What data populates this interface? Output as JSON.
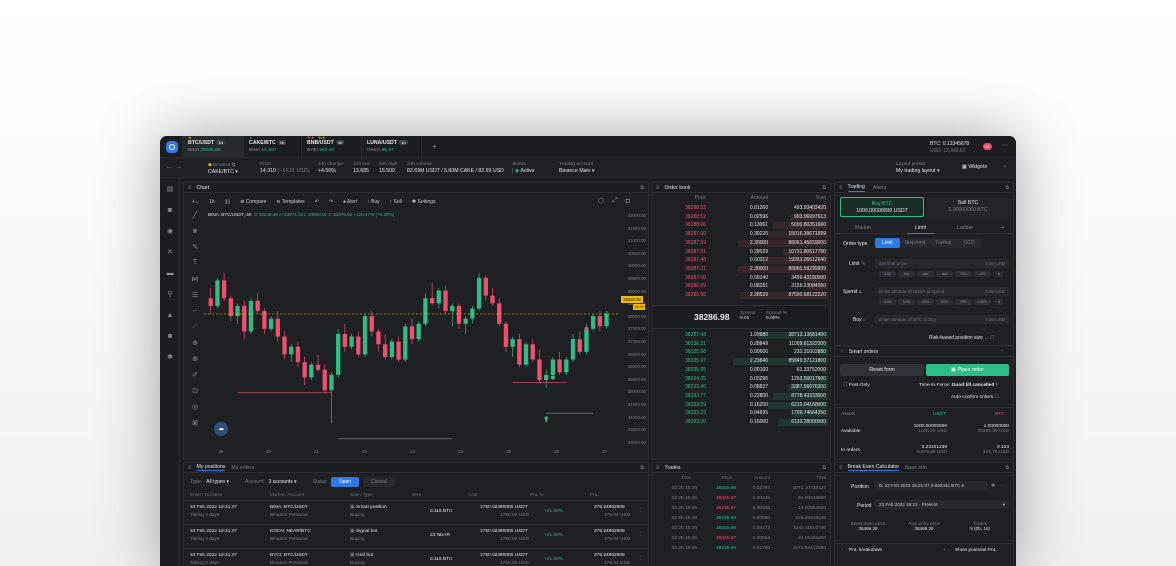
{
  "colors": {
    "green": "#2ebd85",
    "red": "#f0506e",
    "accent": "#2c7be5",
    "bg": "#1e2024",
    "yellow": "#f0b90b"
  },
  "tabs": [
    {
      "pair": "BTC/USDT",
      "badge": "1h",
      "exchange": "BINA",
      "price": "38286.98"
    },
    {
      "pair": "CAKE/BTC",
      "badge": "1h",
      "exchange": "BINA",
      "price": "14.310"
    },
    {
      "pair": "BNB/USDT",
      "badge": "4h",
      "exchange": "BYBI",
      "price": "382.15"
    },
    {
      "pair": "LUNA/USDT",
      "badge": "1h",
      "exchange": "OKEX",
      "price": "65.97"
    }
  ],
  "account": {
    "balance_btc": "BTC: 0.12345678",
    "balance_usd": "USD: 12,345.67",
    "notif": "9+"
  },
  "info": {
    "exchange_label": "Binance",
    "pair": "CAKE/BTC",
    "price_label": "Price",
    "price": "14.310",
    "price_usd": "(~14.31 USD)",
    "change_label": "24h change",
    "change": "+4.56%",
    "low_label": "24h low",
    "low": "13.685",
    "high_label": "24h high",
    "high": "15.500",
    "volume_label": "24h volume",
    "volume": "82.69M USDT / 5.60M CAKE / 82.69 USD",
    "status_label": "Status",
    "status": "Active",
    "account_label": "Trading account",
    "account": "Binance Main",
    "layout_label": "Layout preset",
    "layout": "My trading layout",
    "widgets": "Widgets"
  },
  "chart": {
    "title": "Chart",
    "interval": "1h",
    "compare": "Compare",
    "templates": "Templates",
    "alert": "Alert",
    "buy": "Buy",
    "sell": "Sell",
    "settings": "Settings",
    "symbol": "BINA: BTC/USDT, 60",
    "ohlc": "O 33248.96  H 33574.32  L 33050.02  C 33378.02  +129.47% (+0.39%)",
    "price_tag": "38286.98",
    "time_tag": "14:34",
    "x_ticks": [
      "19",
      "20",
      "21",
      "22",
      "23",
      "24",
      "25",
      "26",
      "27"
    ],
    "y_ticks": [
      "42000.00",
      "41500.00",
      "41000.00",
      "40500.00",
      "40000.00",
      "39500.00",
      "39000.00",
      "38500.00",
      "38000.00",
      "37500.00",
      "37000.00",
      "36500.00",
      "36000.00",
      "35500.00",
      "35000.00",
      "34500.00",
      "34000.00",
      "33500.00",
      "33000.00"
    ]
  },
  "chart_data": {
    "type": "candlestick",
    "ylim": [
      33000,
      42000
    ],
    "x_ticks": [
      "19",
      "20",
      "21",
      "22",
      "23",
      "24",
      "25",
      "26",
      "27"
    ],
    "candles": [
      [
        38900,
        39300,
        38300,
        38600
      ],
      [
        38600,
        39700,
        38500,
        39600
      ],
      [
        39600,
        39900,
        38800,
        38900
      ],
      [
        38900,
        39000,
        38000,
        38200
      ],
      [
        38200,
        38700,
        37900,
        38600
      ],
      [
        38600,
        38800,
        37300,
        37600
      ],
      [
        37600,
        38900,
        37500,
        38800
      ],
      [
        38800,
        39100,
        38300,
        38400
      ],
      [
        38400,
        38500,
        37500,
        37700
      ],
      [
        37700,
        38200,
        37600,
        38100
      ],
      [
        38100,
        38400,
        37200,
        37400
      ],
      [
        37400,
        37600,
        36500,
        36700
      ],
      [
        36700,
        37100,
        36400,
        37000
      ],
      [
        37000,
        37200,
        36200,
        36400
      ],
      [
        36400,
        36600,
        35500,
        35800
      ],
      [
        35800,
        36400,
        35700,
        36300
      ],
      [
        36300,
        36700,
        36000,
        36100
      ],
      [
        36100,
        36300,
        35200,
        35300
      ],
      [
        35300,
        36000,
        34000,
        35900
      ],
      [
        35900,
        37700,
        35800,
        37500
      ],
      [
        37500,
        37900,
        36800,
        37000
      ],
      [
        37000,
        37500,
        36900,
        37400
      ],
      [
        37400,
        37600,
        36600,
        36700
      ],
      [
        36700,
        38300,
        36600,
        38200
      ],
      [
        38200,
        38400,
        37400,
        37600
      ],
      [
        37600,
        37700,
        36800,
        37100
      ],
      [
        37100,
        37500,
        36500,
        36600
      ],
      [
        36600,
        37300,
        36500,
        37200
      ],
      [
        37200,
        37400,
        36400,
        36500
      ],
      [
        36500,
        37900,
        36400,
        37800
      ],
      [
        37800,
        38100,
        37100,
        37300
      ],
      [
        37300,
        38000,
        37200,
        37900
      ],
      [
        37900,
        39100,
        37800,
        38900
      ],
      [
        38900,
        39500,
        38600,
        38700
      ],
      [
        38700,
        39300,
        38500,
        39200
      ],
      [
        39200,
        39400,
        38300,
        38400
      ],
      [
        38400,
        38700,
        37800,
        38600
      ],
      [
        38600,
        38700,
        37700,
        37900
      ],
      [
        37900,
        38200,
        37500,
        38100
      ],
      [
        38100,
        38600,
        37900,
        38500
      ],
      [
        38500,
        39900,
        38400,
        39700
      ],
      [
        39700,
        39800,
        38800,
        39000
      ],
      [
        39000,
        39300,
        38600,
        38700
      ],
      [
        38700,
        38900,
        37800,
        37900
      ],
      [
        37900,
        38000,
        36800,
        37000
      ],
      [
        37000,
        37400,
        36600,
        37300
      ],
      [
        37300,
        37500,
        36200,
        36300
      ],
      [
        36300,
        37200,
        36200,
        37100
      ],
      [
        37100,
        37300,
        36400,
        36500
      ],
      [
        36500,
        36900,
        35600,
        35700
      ],
      [
        35700,
        36100,
        35400,
        35900
      ],
      [
        35900,
        36600,
        35800,
        36500
      ],
      [
        36500,
        36800,
        35900,
        36000
      ],
      [
        36000,
        36600,
        35900,
        36500
      ],
      [
        36500,
        37500,
        36400,
        37300
      ],
      [
        37300,
        37600,
        36700,
        36800
      ],
      [
        36800,
        37900,
        36700,
        37700
      ],
      [
        37700,
        38300,
        37600,
        38200
      ],
      [
        38200,
        38400,
        37600,
        37800
      ],
      [
        37800,
        38400,
        37700,
        38300
      ]
    ]
  },
  "orderbook": {
    "title": "Order book",
    "headers": [
      "Price",
      "Amount",
      "Sum"
    ],
    "asks": [
      [
        "38288.52",
        "0.01260",
        "493.93403420"
      ],
      [
        "38288.52",
        "0.02596",
        "993.96997613"
      ],
      [
        "38288.06",
        "0.13061",
        "5000.80351660"
      ],
      [
        "38287.60",
        "0.39220",
        "15016.39671999"
      ],
      [
        "38287.59",
        "2.30000",
        "88061.45659000"
      ],
      [
        "38287.51",
        "0.28029",
        "10731.80617790"
      ],
      [
        "38287.48",
        "0.50312",
        "19263.06612640"
      ],
      [
        "38287.21",
        "2.30000",
        "88060.58299999"
      ],
      [
        "38287.00",
        "0.09140",
        "3499.43180000"
      ],
      [
        "38286.99",
        "0.08281",
        "3155.23084560"
      ],
      [
        "38286.98",
        "2.28539",
        "87500.68122220"
      ]
    ],
    "spread_price": "38286.98",
    "spread_label": "Spread",
    "spread_value": "0.01",
    "spread_pct_label": "Spread %",
    "spread_pct": "0.00%",
    "bids": [
      [
        "38287.43",
        "1.00980",
        "38713.13681400"
      ],
      [
        "38336.21",
        "0.28849",
        "11059.61322200"
      ],
      [
        "38335.98",
        "0.00606",
        "232.31603880"
      ],
      [
        "38335.97",
        "2.23840",
        "85849.57121800"
      ],
      [
        "38335.95",
        "0.00160",
        "61.33752000"
      ],
      [
        "38334.35",
        "0.03296",
        "1263.50017600"
      ],
      [
        "38333.40",
        "0.08837",
        "3387.56676300"
      ],
      [
        "38333.77",
        "0.22800",
        "8778.43333000"
      ],
      [
        "38333.59",
        "0.16200",
        "6210.04168000"
      ],
      [
        "38333.23",
        "0.04695",
        "1799.74664350"
      ],
      [
        "38333.00",
        "0.16000",
        "6133.28000000"
      ]
    ]
  },
  "trading": {
    "tabs": [
      "Trading",
      "Alerts"
    ],
    "buy_label": "Buy BTC",
    "buy_amount": "1000.00000000 USDT",
    "sell_label": "Sell BTC",
    "sell_amount": "1.00000000 BTC",
    "modes": [
      "Market",
      "Limit",
      "Ladder"
    ],
    "order_type_label": "Order type",
    "order_types": [
      "Limit",
      "Stop limit",
      "Trailing",
      "OCO"
    ],
    "limit_label": "Limit",
    "limit_placeholder": "Set limit price",
    "limit_unit": "0.00 USD",
    "limit_pills": [
      "0.00",
      "bid",
      "ask",
      "last",
      "+5%",
      "-5%"
    ],
    "spend_label": "Spend",
    "spend_placeholder": "Enter amount of USDT to spend",
    "spend_unit": "0.00 USD",
    "spend_pills": [
      "0.00",
      "10%",
      "25%",
      "50%",
      "75%",
      "100%"
    ],
    "buy_field_label": "Buy",
    "buy_placeholder": "Enter amount of BTC to buy",
    "buy_unit": "0.00 USD",
    "risk": "Risk-based position size",
    "smart_orders": "Smart orders",
    "reset": "Reset form",
    "place": "Place order",
    "post_only": "Post-Only",
    "tif_label": "Time-In-Force:",
    "tif": "Good till cancelled",
    "auto_confirm": "Auto-confirm orders",
    "assets_label": "Assets",
    "assets_usdt": "USDT",
    "assets_btc": "BTC",
    "available_label": "Available",
    "avail_usdt": "1000.00000000",
    "avail_usdt_usd": "1000.00 USD",
    "avail_btc": "1.00000000",
    "avail_btc_usd": "38286.98 USD",
    "inorders_label": "In orders",
    "inorders_usdt": "0.23101239",
    "inorders_usdt_usd": "0.678.66 USD",
    "inorders_btc": "0.153",
    "inorders_btc_usd": "124.78 USD"
  },
  "positions": {
    "tabs": [
      "My positions",
      "My orders"
    ],
    "type_label": "Type:",
    "type": "All types",
    "account_label": "Account:",
    "account": "3 accounts",
    "status_label": "Status",
    "status_open": "Open",
    "status_closed": "Closed",
    "headers": [
      "Enter / Duration",
      "Market / Account",
      "Side / Type",
      "Size",
      "Cost",
      "PnL %",
      "PnL"
    ],
    "rows": [
      {
        "date": "23 Feb 2022 19:21:37",
        "dur": "Taking 2 days",
        "market": "BINA: BTC/USDT",
        "acct": "Binance Personal",
        "type": "Smart position",
        "side": "Buying",
        "size": "0.116 BTC",
        "cost": "1750.02360000 USDT",
        "cost2": "1750.02 USD",
        "pnl_pct": "+41.20%",
        "pnl": "379.24892808",
        "pnl2": "379.24 USD"
      },
      {
        "date": "23 Feb 2022 19:21:37",
        "dur": "Taking 2 days",
        "market": "KOCN: NEAR/BTC",
        "acct": "Binance Personal",
        "type": "Signal bot",
        "side": "Buying",
        "size": "23 NEAR",
        "cost": "1750.02360000 USDT",
        "cost2": "1750.02 USD",
        "pnl_pct": "+41.20%",
        "pnl": "379.24892808",
        "pnl2": "379.24 USD"
      },
      {
        "date": "23 Feb 2022 19:21:37",
        "dur": "Taking 2 days",
        "market": "BYCI: BTC/USDT",
        "acct": "Binance Personal",
        "type": "Grid bot",
        "side": "Buying",
        "size": "0.116 BTC",
        "cost": "1750.02360000 USDT",
        "cost2": "1750.02 USD",
        "pnl_pct": "+41.20%",
        "pnl": "379.24892808",
        "pnl2": "379.24 USD"
      }
    ]
  },
  "trades": {
    "title": "Trades",
    "headers": [
      "Time",
      "Price",
      "Amount",
      "Total"
    ],
    "rows": [
      [
        "02:25 15:36",
        "38335.98",
        "0.02794",
        "1071.10728120",
        "g"
      ],
      [
        "02:25 15:36",
        "38335.97",
        "0.00240",
        "92.00633800",
        "r"
      ],
      [
        "02:25 15:36",
        "38335.97",
        "0.00036",
        "13.80094920",
        "r"
      ],
      [
        "02:25 15:36",
        "38335.98",
        "0.00590",
        "226.28416040",
        "g"
      ],
      [
        "02:25 15:36",
        "38335.98",
        "0.08173",
        "3243.11516740",
        "g"
      ],
      [
        "02:25 15:36",
        "38335.97",
        "0.00063",
        "24.15155200",
        "r"
      ],
      [
        "02:25 15:36",
        "38335.98",
        "0.02790",
        "1071.64412880",
        "g"
      ]
    ]
  },
  "breakeven": {
    "tabs": [
      "Break Even Calculator",
      "Base info"
    ],
    "position_label": "Position",
    "position": "B: 23 Feb 2022 19:21:37 0.092341 BTC",
    "period_label": "Period",
    "period": "23 Feb 2022 19:21 - Present",
    "be_label": "Break even price",
    "be": "36469.29",
    "avg_label": "Avg. entry price",
    "avg": "36469.29",
    "trades_label": "Trades",
    "trades": "8 (0b, 1s)",
    "pnl_label": "PnL breakdown",
    "show_label": "Show potential PnL"
  }
}
